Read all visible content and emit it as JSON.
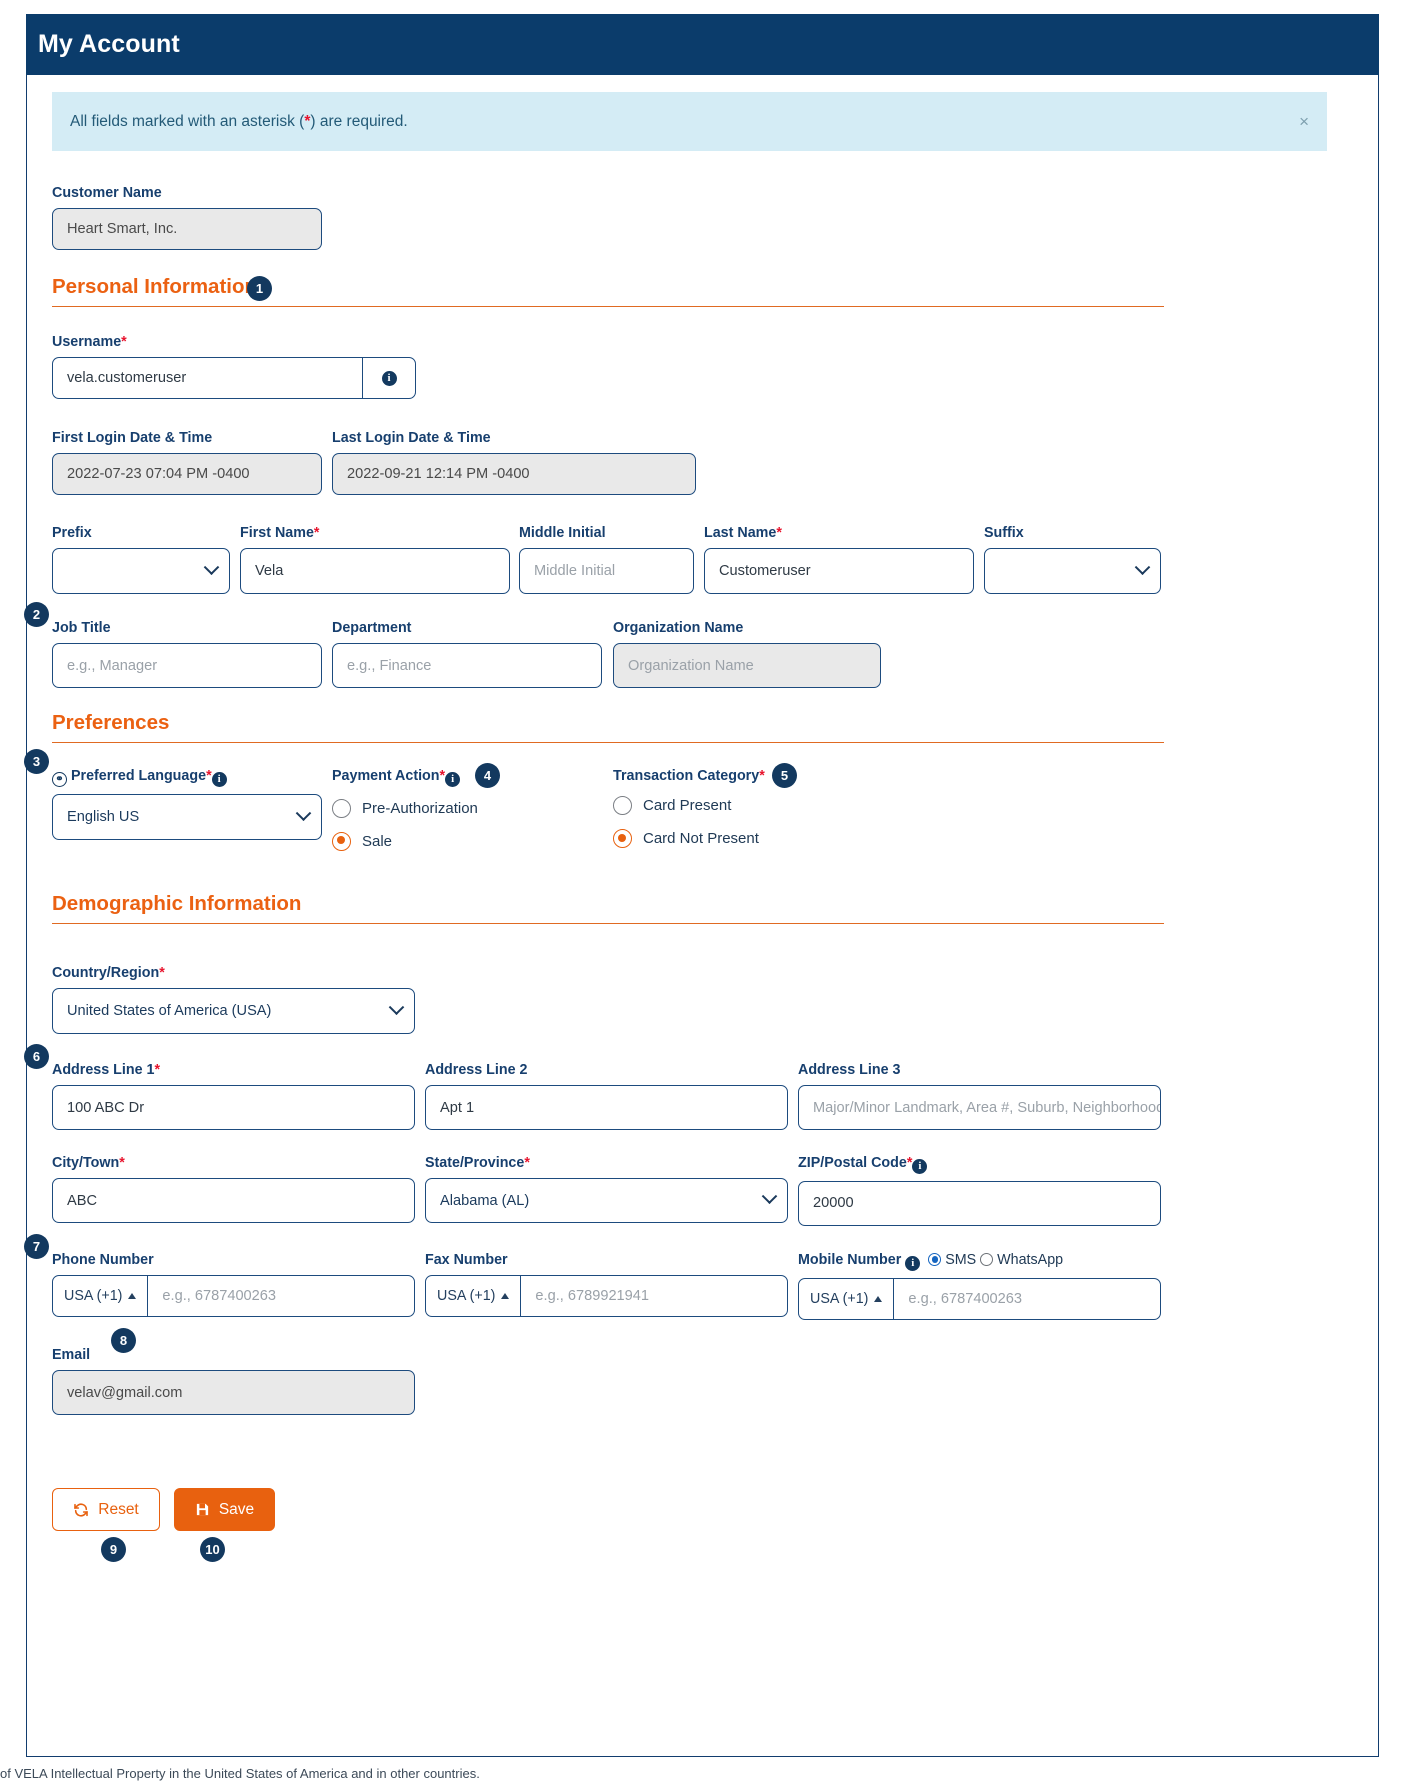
{
  "window": {
    "title": "My Account"
  },
  "notice": {
    "text_before": "All fields marked with an asterisk (",
    "asterisk": "*",
    "text_after": ") are required.",
    "close_label": "×"
  },
  "customer": {
    "label": "Customer Name",
    "value": "Heart Smart, Inc."
  },
  "sections": {
    "personal": "Personal Information",
    "preferences": "Preferences",
    "demographic": "Demographic Information"
  },
  "badges": {
    "b1": "1",
    "b2": "2",
    "b3": "3",
    "b4": "4",
    "b5": "5",
    "b6": "6",
    "b7": "7",
    "b8": "8",
    "b9": "9",
    "b10": "10"
  },
  "personal": {
    "username_label": "Username",
    "username_value": "vela.customeruser",
    "username_info": "i",
    "first_login_label": "First Login Date & Time",
    "first_login_value": "2022-07-23 07:04 PM -0400",
    "last_login_label": "Last Login Date & Time",
    "last_login_value": "2022-09-21 12:14 PM -0400",
    "prefix_label": "Prefix",
    "prefix_value": "",
    "first_name_label": "First Name",
    "first_name_value": "Vela",
    "middle_initial_label": "Middle Initial",
    "middle_initial_placeholder": "Middle Initial",
    "last_name_label": "Last Name",
    "last_name_value": "Customeruser",
    "suffix_label": "Suffix",
    "suffix_value": "",
    "job_title_label": "Job Title",
    "job_title_placeholder": "e.g., Manager",
    "department_label": "Department",
    "department_placeholder": "e.g., Finance",
    "organization_label": "Organization Name",
    "organization_placeholder": "Organization Name"
  },
  "preferences": {
    "language_label": "Preferred Language",
    "language_value": "English US",
    "payment_action_label": "Payment Action",
    "payment_options": [
      {
        "label": "Pre-Authorization",
        "selected": false
      },
      {
        "label": "Sale",
        "selected": true
      }
    ],
    "transaction_category_label": "Transaction Category",
    "transaction_options": [
      {
        "label": "Card Present",
        "selected": false
      },
      {
        "label": "Card Not Present",
        "selected": true
      }
    ]
  },
  "demographic": {
    "country_label": "Country/Region",
    "country_value": "United States of America (USA)",
    "address1_label": "Address Line 1",
    "address1_value": "100 ABC Dr",
    "address2_label": "Address Line 2",
    "address2_value": "Apt 1",
    "address3_label": "Address Line 3",
    "address3_placeholder": "Major/Minor Landmark, Area #, Suburb, Neighborhood",
    "city_label": "City/Town",
    "city_value": "ABC",
    "state_label": "State/Province",
    "state_value": "Alabama (AL)",
    "zip_label": "ZIP/Postal Code",
    "zip_value": "20000",
    "phone_label": "Phone Number",
    "phone_country": "USA (+1)",
    "phone_placeholder": "e.g., 6787400263",
    "fax_label": "Fax Number",
    "fax_country": "USA (+1)",
    "fax_placeholder": "e.g., 6789921941",
    "mobile_label": "Mobile Number",
    "mobile_country": "USA (+1)",
    "mobile_placeholder": "e.g., 6787400263",
    "sms_label": "SMS",
    "whatsapp_label": "WhatsApp",
    "email_label": "Email",
    "email_value": "velav@gmail.com"
  },
  "actions": {
    "reset_label": "Reset",
    "save_label": "Save"
  },
  "footer": {
    "text": "of VELA Intellectual Property in the United States of America and in other countries."
  },
  "colors": {
    "header_blue": "#0b3c6b",
    "accent_orange": "#eb6112",
    "required_red": "#e8142d",
    "notice_bg": "#d4ecf5",
    "field_border": "#1d4b7e",
    "readonly_bg": "#e9e9e9"
  }
}
